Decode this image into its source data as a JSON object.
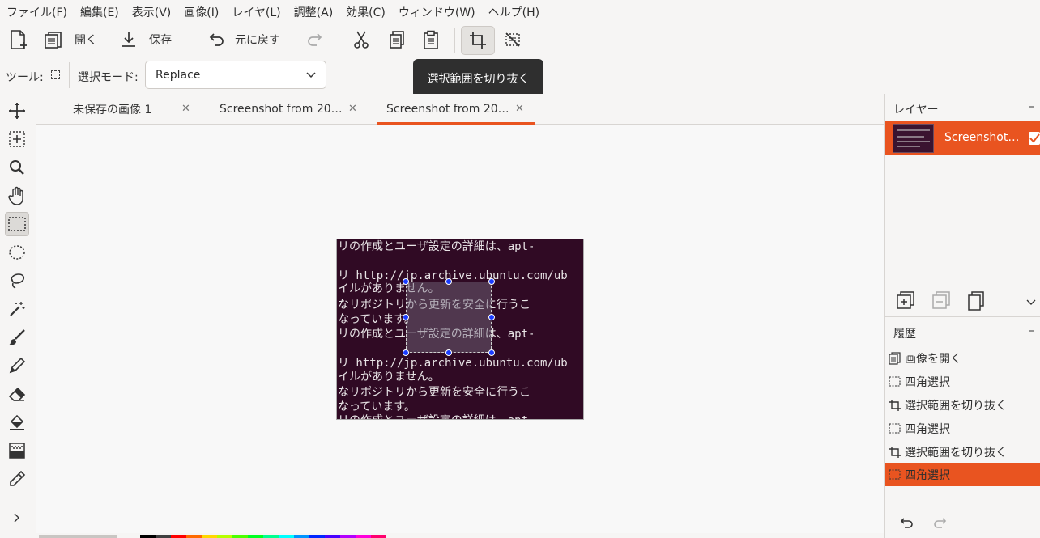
{
  "menubar": {
    "items": [
      "ファイル(F)",
      "編集(E)",
      "表示(V)",
      "画像(I)",
      "レイヤ(L)",
      "調整(A)",
      "効果(C)",
      "ウィンドウ(W)",
      "ヘルプ(H)"
    ]
  },
  "toolbar": {
    "new_icon": "new-image-icon",
    "open_label": "開く",
    "save_label": "保存",
    "undo_label": "元に戻す",
    "redo_icon": "redo-icon",
    "cut_icon": "cut-icon",
    "copy_icon": "copy-icon",
    "paste_icon": "paste-icon",
    "crop_icon": "crop-to-selection-icon",
    "deselect_icon": "deselect-icon"
  },
  "tool_options": {
    "tool_label": "ツール:",
    "selection_mode_label": "選択モード:",
    "selection_mode_value": "Replace"
  },
  "tooltip": {
    "text": "選択範囲を切り抜く"
  },
  "tabs": [
    {
      "label": "未保存の画像 1",
      "active": false
    },
    {
      "label": "Screenshot from 20…",
      "active": false
    },
    {
      "label": "Screenshot from 20…",
      "active": true
    }
  ],
  "image_text": {
    "lines": [
      "リの作成とユーザ設定の詳細は、apt-",
      "",
      "リ http://jp.archive.ubuntu.com/ub",
      "イルがありません。",
      "なリポジトリから更新を安全に行うこ",
      "なっています。",
      "リの作成とユーザ設定の詳細は、apt-",
      "",
      "リ http://jp.archive.ubuntu.com/ub",
      "イルがありません。",
      "なリポジトリから更新を安全に行うこ",
      "なっています。",
      "リの作成とユーザ設定の詳細は、apt-"
    ]
  },
  "layers_panel": {
    "title": "レイヤー",
    "layer_name": "Screenshot…"
  },
  "history_panel": {
    "title": "履歴",
    "items": [
      {
        "label": "画像を開く",
        "icon": "open-image-icon",
        "active": false
      },
      {
        "label": "四角選択",
        "icon": "rectangle-select-icon",
        "active": false
      },
      {
        "label": "選択範囲を切り抜く",
        "icon": "crop-icon",
        "active": false
      },
      {
        "label": "四角選択",
        "icon": "rectangle-select-icon",
        "active": false
      },
      {
        "label": "選択範囲を切り抜く",
        "icon": "crop-icon",
        "active": false
      },
      {
        "label": "四角選択",
        "icon": "rectangle-select-icon",
        "active": true
      }
    ]
  },
  "colors": {
    "accent": "#e95420",
    "terminal_bg": "#300a24",
    "handle": "#1a3cff"
  }
}
